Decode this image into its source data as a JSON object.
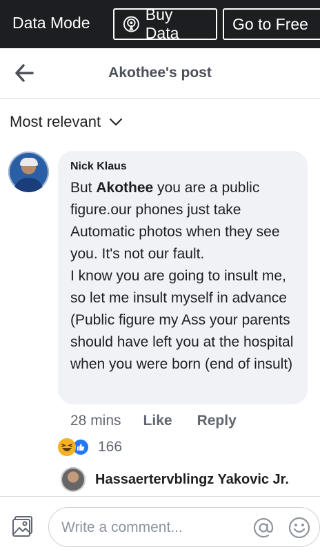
{
  "data_bar": {
    "mode_label": "Data Mode",
    "buy_label": "Buy Data",
    "free_label": "Go to Free"
  },
  "header": {
    "title": "Akothee's post"
  },
  "sort": {
    "label": "Most relevant"
  },
  "comment": {
    "author": "Nick Klaus",
    "text_before_mention": "But ",
    "mention": "Akothee",
    "text_after_mention": " you are a public figure.our phones just take Automatic photos when they see you. It's not our fault.",
    "text_second_paragraph": "I know you are going to insult me, so let me insult myself in advance (Public figure my Ass your parents should have left you at the hospital when you were born (end of insult)",
    "time": "28 mins",
    "like_label": "Like",
    "reply_label": "Reply",
    "reaction_count": "166",
    "reactions": [
      "haha-icon",
      "like-icon"
    ]
  },
  "reply": {
    "author": "Hassaertervblingz Yakovic Jr."
  },
  "composer": {
    "placeholder": "Write a comment..."
  },
  "colors": {
    "data_bar_bg": "#1c1e21",
    "bubble_bg": "#f0f2f5",
    "meta_text": "#606770",
    "like_blue": "#2078f4",
    "haha_yellow": "#f7b125"
  }
}
